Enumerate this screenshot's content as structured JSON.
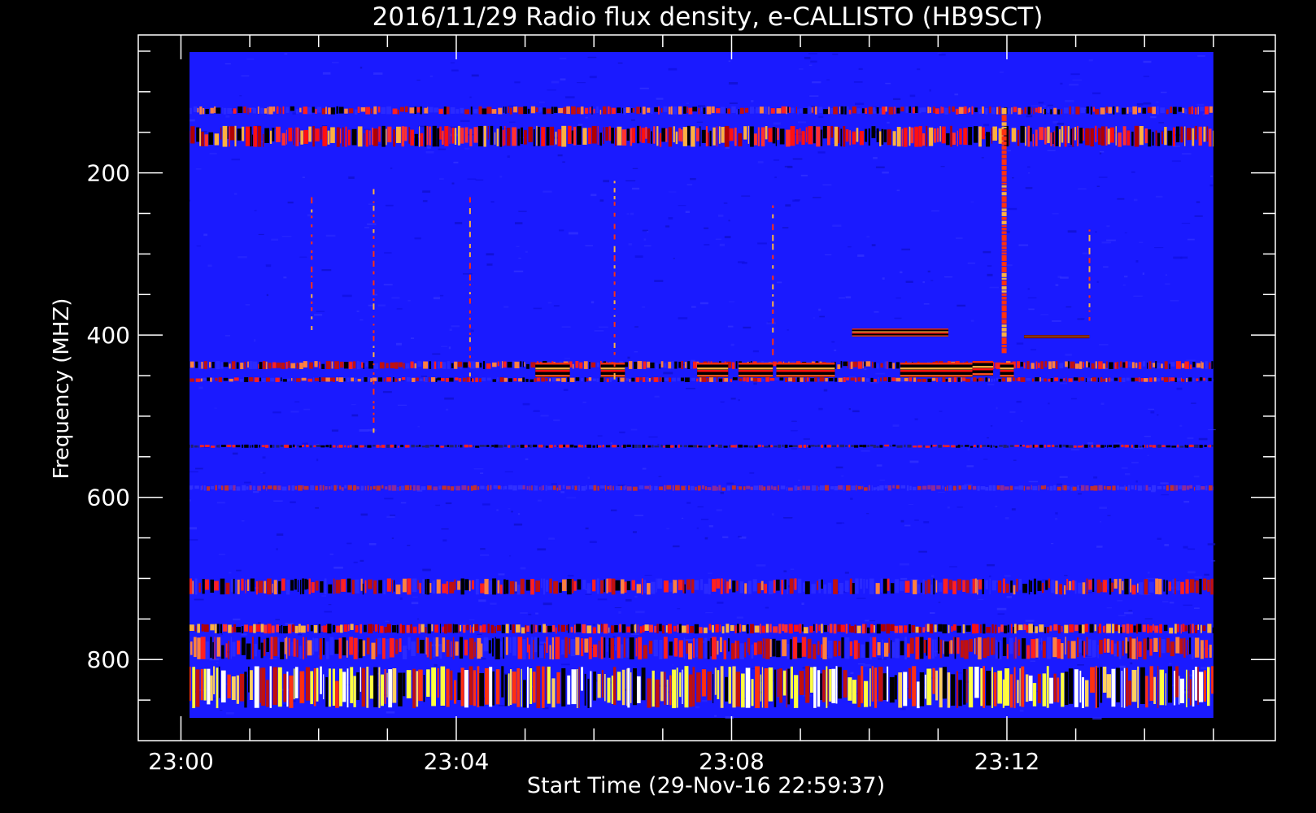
{
  "chart_data": {
    "type": "heatmap",
    "title": "2016/11/29  Radio flux density, e-CALLISTO (HB9SCT)",
    "xlabel": "Start Time (29-Nov-16 22:59:37)",
    "ylabel": "Frequency (MHZ)",
    "x_ticks": [
      "23:00",
      "23:04",
      "23:08",
      "23:12"
    ],
    "y_ticks": [
      "200",
      "400",
      "600",
      "800"
    ],
    "x_range_min": [
      -0.62,
      15.9
    ],
    "data_extent_min": [
      0,
      15
    ],
    "y_range_mhz": [
      30,
      900
    ],
    "data_extent_mhz": [
      50,
      872
    ],
    "colormap": [
      "#000000",
      "#2121ff",
      "#ff0000",
      "#ffff40",
      "#ffffff"
    ],
    "background_color": "#1a1aff",
    "features": [
      {
        "kind": "band",
        "fmin": 118,
        "fmax": 128,
        "intensity": "moderate"
      },
      {
        "kind": "band",
        "fmin": 142,
        "fmax": 168,
        "intensity": "strong"
      },
      {
        "kind": "band",
        "fmin": 432,
        "fmax": 442,
        "intensity": "moderate"
      },
      {
        "kind": "band",
        "fmin": 452,
        "fmax": 458,
        "intensity": "moderate"
      },
      {
        "kind": "band",
        "fmin": 535,
        "fmax": 539,
        "intensity": "dark"
      },
      {
        "kind": "band",
        "fmin": 585,
        "fmax": 592,
        "intensity": "weak"
      },
      {
        "kind": "band",
        "fmin": 700,
        "fmax": 720,
        "intensity": "moderate"
      },
      {
        "kind": "band",
        "fmin": 756,
        "fmax": 768,
        "intensity": "strong"
      },
      {
        "kind": "band",
        "fmin": 772,
        "fmax": 800,
        "intensity": "moderate"
      },
      {
        "kind": "band",
        "fmin": 808,
        "fmax": 860,
        "intensity": "very strong"
      },
      {
        "kind": "burst",
        "t_start": 5.15,
        "t_end": 5.65,
        "fmin": 434,
        "fmax": 452
      },
      {
        "kind": "burst",
        "t_start": 6.1,
        "t_end": 6.45,
        "fmin": 434,
        "fmax": 452
      },
      {
        "kind": "burst",
        "t_start": 7.5,
        "t_end": 7.95,
        "fmin": 434,
        "fmax": 452
      },
      {
        "kind": "burst",
        "t_start": 8.1,
        "t_end": 8.6,
        "fmin": 434,
        "fmax": 452
      },
      {
        "kind": "burst",
        "t_start": 8.65,
        "t_end": 9.5,
        "fmin": 434,
        "fmax": 452
      },
      {
        "kind": "burst",
        "t_start": 9.75,
        "t_end": 11.15,
        "fmin": 392,
        "fmax": 402
      },
      {
        "kind": "burst",
        "t_start": 10.45,
        "t_end": 11.5,
        "fmin": 434,
        "fmax": 452
      },
      {
        "kind": "burst",
        "t_start": 11.5,
        "t_end": 11.8,
        "fmin": 432,
        "fmax": 450
      },
      {
        "kind": "burst",
        "t_start": 11.9,
        "t_end": 12.1,
        "fmin": 434,
        "fmax": 452
      },
      {
        "kind": "burst",
        "t_start": 12.25,
        "t_end": 13.2,
        "fmin": 400,
        "fmax": 404
      },
      {
        "kind": "vline",
        "t": 11.96,
        "fmin": 120,
        "fmax": 420
      },
      {
        "kind": "vline",
        "t": 2.8,
        "fmin": 220,
        "fmax": 520
      },
      {
        "kind": "vline",
        "t": 6.3,
        "fmin": 210,
        "fmax": 460
      },
      {
        "kind": "vline",
        "t": 1.9,
        "fmin": 230,
        "fmax": 400
      },
      {
        "kind": "vline",
        "t": 4.2,
        "fmin": 230,
        "fmax": 450
      },
      {
        "kind": "vline",
        "t": 8.6,
        "fmin": 240,
        "fmax": 420
      },
      {
        "kind": "vline",
        "t": 13.2,
        "fmin": 270,
        "fmax": 380
      }
    ]
  }
}
